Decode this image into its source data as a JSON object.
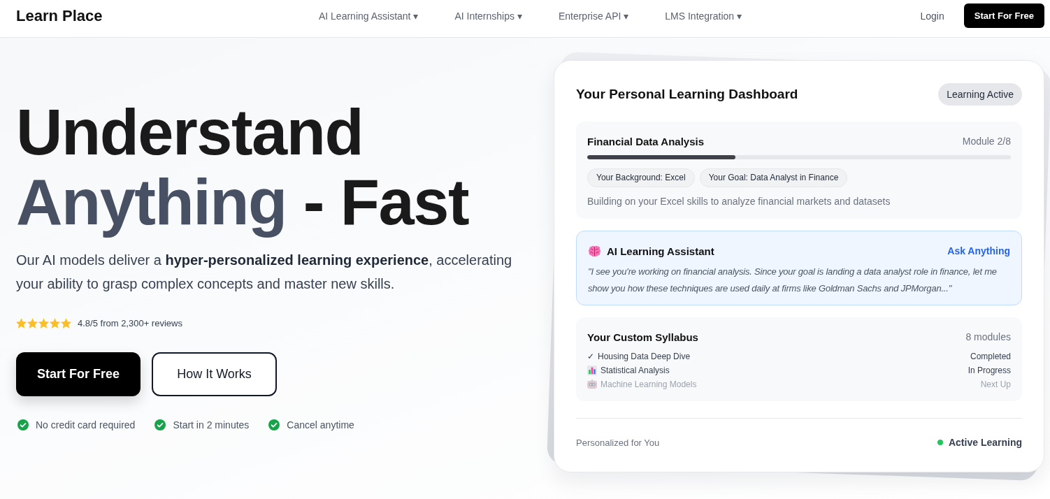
{
  "nav": {
    "logo": "Learn Place",
    "menu": [
      "AI Learning Assistant ▾",
      "AI Internships ▾",
      "Enterprise API ▾",
      "LMS Integration ▾"
    ],
    "login": "Login",
    "cta": "Start For Free"
  },
  "hero": {
    "headline": [
      [
        {
          "text": "Understand",
          "accent": false
        }
      ],
      [
        {
          "text": "Anything",
          "accent": true
        },
        {
          "text": "- Fast",
          "accent": false
        }
      ]
    ],
    "description": "Our AI models deliver a **hyper-personalized learning experience**, accelerating your ability to grasp complex concepts and master new skills.",
    "rating": {
      "stars": 5,
      "text": "4.8/5 from 2,300+ reviews"
    },
    "buttons": [
      {
        "label": "Start For Free",
        "kind": "primary"
      },
      {
        "label": "How It Works",
        "kind": "secondary"
      }
    ],
    "perks": [
      "No credit card required",
      "Start in 2 minutes",
      "Cancel anytime"
    ]
  },
  "dashboard": {
    "title": "Your Personal Learning Dashboard",
    "badge": "Learning Active",
    "course": {
      "title": "Financial Data Analysis",
      "module": "Module 2/8",
      "progress": {
        "level": 0.35
      },
      "tags": [
        "Your Background: Excel",
        "Your Goal: Data Analyst in Finance"
      ],
      "note": "Building on your Excel skills to analyze financial markets and datasets"
    },
    "assistant": {
      "title": "AI Learning Assistant",
      "link": "Ask Anything",
      "quote": "\"I see you're working on financial analysis. Since your goal is landing a data analyst role in finance, let me show you how these techniques are used daily at firms like Goldman Sachs and JPMorgan...\""
    },
    "syllabus": {
      "title": "Your Custom Syllabus",
      "count": "8 modules",
      "items": [
        {
          "kind": "check",
          "mark": "✓",
          "name": "Housing Data Deep Dive",
          "status": "Completed",
          "dimmed": false
        },
        {
          "kind": "chart",
          "name": "Statistical Analysis",
          "status": "In Progress",
          "dimmed": false
        },
        {
          "kind": "robot",
          "name": "Machine Learning Models",
          "status": "Next Up",
          "dimmed": true
        }
      ]
    },
    "footer": {
      "label": "Personalized for You",
      "status": "Active Learning"
    }
  }
}
